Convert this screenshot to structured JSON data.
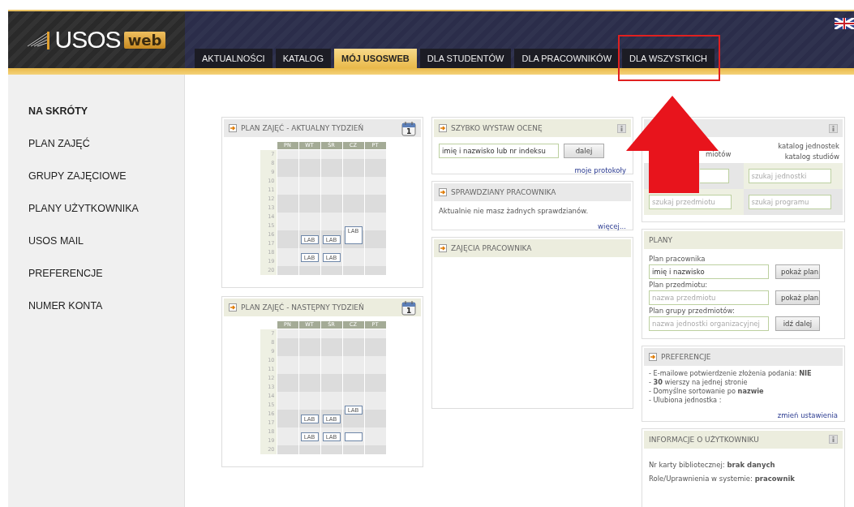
{
  "header": {
    "logo": {
      "text": "USOS",
      "badge": "web"
    }
  },
  "nav": [
    {
      "label": "AKTUALNOŚCI",
      "selected": false
    },
    {
      "label": "KATALOG",
      "selected": false
    },
    {
      "label": "MÓJ USOSWEB",
      "selected": true
    },
    {
      "label": "DLA STUDENTÓW",
      "selected": false
    },
    {
      "label": "DLA PRACOWNIKÓW",
      "selected": false
    },
    {
      "label": "DLA WSZYSTKICH",
      "selected": false
    }
  ],
  "sidebar": {
    "items": [
      {
        "label": "NA SKRÓTY",
        "kind": "heading"
      },
      {
        "label": "PLAN ZAJĘĆ",
        "kind": "link"
      },
      {
        "label": "GRUPY ZAJĘCIOWE",
        "kind": "link"
      },
      {
        "label": "PLANY UŻYTKOWNIKA",
        "kind": "link"
      },
      {
        "label": "USOS MAIL",
        "kind": "link"
      },
      {
        "label": "PREFERENCJE",
        "kind": "link"
      },
      {
        "label": "NUMER KONTA",
        "kind": "link"
      }
    ]
  },
  "timetables": [
    {
      "title": "PLAN ZAJĘĆ - AKTUALNY TYDZIEŃ",
      "calendar_day": "1",
      "hours": [
        "7",
        "8",
        "9",
        "10",
        "11",
        "12",
        "13",
        "14",
        "15",
        "16",
        "17",
        "18",
        "19",
        "20"
      ],
      "days": [
        {
          "label": "PN"
        },
        {
          "label": "WT",
          "slots": [
            {
              "kind": "free"
            },
            {
              "kind": "free"
            },
            {
              "kind": "free"
            },
            {
              "kind": "free"
            },
            {
              "kind": "free"
            },
            {
              "kind": "free"
            },
            {
              "kind": "free"
            },
            {
              "kind": "free"
            },
            {
              "kind": "free"
            },
            {
              "kind": "start",
              "label": "LAB"
            },
            {
              "kind": "more"
            },
            {
              "kind": "start",
              "label": "LAB"
            },
            {
              "kind": "more"
            },
            {
              "kind": "free"
            }
          ]
        },
        {
          "label": "ŚR",
          "slots": [
            {
              "kind": "free"
            },
            {
              "kind": "free"
            },
            {
              "kind": "free"
            },
            {
              "kind": "free"
            },
            {
              "kind": "free"
            },
            {
              "kind": "free"
            },
            {
              "kind": "free"
            },
            {
              "kind": "free"
            },
            {
              "kind": "free"
            },
            {
              "kind": "start",
              "label": "LAB"
            },
            {
              "kind": "more"
            },
            {
              "kind": "start",
              "label": "LAB"
            },
            {
              "kind": "more"
            },
            {
              "kind": "free"
            }
          ]
        },
        {
          "label": "CZ",
          "slots": [
            {
              "kind": "free"
            },
            {
              "kind": "free"
            },
            {
              "kind": "free"
            },
            {
              "kind": "free"
            },
            {
              "kind": "free"
            },
            {
              "kind": "free"
            },
            {
              "kind": "free"
            },
            {
              "kind": "free"
            },
            {
              "kind": "start",
              "label": "LAB"
            },
            {
              "kind": "more"
            },
            {
              "kind": "more"
            },
            {
              "kind": "free"
            },
            {
              "kind": "free"
            },
            {
              "kind": "free"
            }
          ]
        },
        {
          "label": "PT"
        }
      ]
    },
    {
      "title": "PLAN ZAJĘĆ - NASTĘPNY TYDZIEŃ",
      "calendar_day": "1",
      "hours": [
        "7",
        "8",
        "9",
        "10",
        "11",
        "12",
        "13",
        "14",
        "15",
        "16",
        "17",
        "18",
        "19",
        "20"
      ],
      "days": [
        {
          "label": "PN"
        },
        {
          "label": "WT",
          "slots": [
            {
              "kind": "free"
            },
            {
              "kind": "free"
            },
            {
              "kind": "free"
            },
            {
              "kind": "free"
            },
            {
              "kind": "free"
            },
            {
              "kind": "free"
            },
            {
              "kind": "free"
            },
            {
              "kind": "free"
            },
            {
              "kind": "free"
            },
            {
              "kind": "start",
              "label": "LAB"
            },
            {
              "kind": "more"
            },
            {
              "kind": "start",
              "label": "LAB"
            },
            {
              "kind": "more"
            },
            {
              "kind": "free"
            }
          ]
        },
        {
          "label": "ŚR",
          "slots": [
            {
              "kind": "free"
            },
            {
              "kind": "free"
            },
            {
              "kind": "free"
            },
            {
              "kind": "free"
            },
            {
              "kind": "free"
            },
            {
              "kind": "free"
            },
            {
              "kind": "free"
            },
            {
              "kind": "free"
            },
            {
              "kind": "free"
            },
            {
              "kind": "start",
              "label": "LAB"
            },
            {
              "kind": "more"
            },
            {
              "kind": "start",
              "label": "LAB"
            },
            {
              "kind": "more"
            },
            {
              "kind": "free"
            }
          ]
        },
        {
          "label": "CZ",
          "slots": [
            {
              "kind": "free"
            },
            {
              "kind": "free"
            },
            {
              "kind": "free"
            },
            {
              "kind": "free"
            },
            {
              "kind": "free"
            },
            {
              "kind": "free"
            },
            {
              "kind": "free"
            },
            {
              "kind": "free"
            },
            {
              "kind": "start",
              "label": "LAB"
            },
            {
              "kind": "more"
            },
            {
              "kind": "free"
            },
            {
              "kind": "start"
            },
            {
              "kind": "more"
            },
            {
              "kind": "free"
            }
          ]
        },
        {
          "label": "PT"
        }
      ]
    }
  ],
  "quick_grade": {
    "title": "SZYBKO WYSTAW OCENĘ",
    "info": true,
    "value": "imię i nazwisko lub nr indeksu",
    "button": "dalej",
    "link": "moje protokoły"
  },
  "tests": {
    "title": "SPRAWDZIANY PRACOWNIKA",
    "message": "Aktualnie nie masz żadnych sprawdzianów.",
    "link": "więcej..."
  },
  "classes": {
    "title": "ZAJĘCIA PRACOWNIKA"
  },
  "catalog": {
    "info": true,
    "left_link": "miotów",
    "right_links": [
      "katalog jednostek",
      "katalog studiów"
    ],
    "fields": [
      {
        "kind": "partial"
      },
      {
        "kind": "field",
        "placeholder": "szukaj jednostki"
      },
      {
        "kind": "field",
        "placeholder": "szukaj przedmiotu"
      },
      {
        "kind": "field",
        "placeholder": "szukaj programu"
      }
    ]
  },
  "plans": {
    "title": "PLANY",
    "rows": [
      {
        "label": "Plan pracownika",
        "value": "imię i nazwisko",
        "button": "pokaż plan"
      },
      {
        "label": "Plan przedmiotu:",
        "placeholder": "nazwa przedmiotu",
        "button": "pokaż plan"
      },
      {
        "label": "Plan grupy przedmiotów:",
        "placeholder": "nazwa jednostki organizacyjnej",
        "button": "idź dalej"
      }
    ]
  },
  "preferences": {
    "title": "PREFERENCJE",
    "lines": [
      "- E-mailowe potwierdzenie złożenia podania: **NIE**",
      "- **30** wierszy na jednej stronie",
      "- Domyślne sortowanie po **nazwie**",
      "- Ulubiona jednostka :"
    ],
    "link": "zmień ustawienia"
  },
  "user_info": {
    "title": "INFORMACJE O UŻYTKOWNIKU",
    "info": true,
    "lines": [
      "Nr karty bibliotecznej: **brak danych**",
      "Role/Uprawnienia w systemie: **pracownik**"
    ]
  },
  "annotations": {
    "highlight_box": true,
    "arrow": true
  }
}
